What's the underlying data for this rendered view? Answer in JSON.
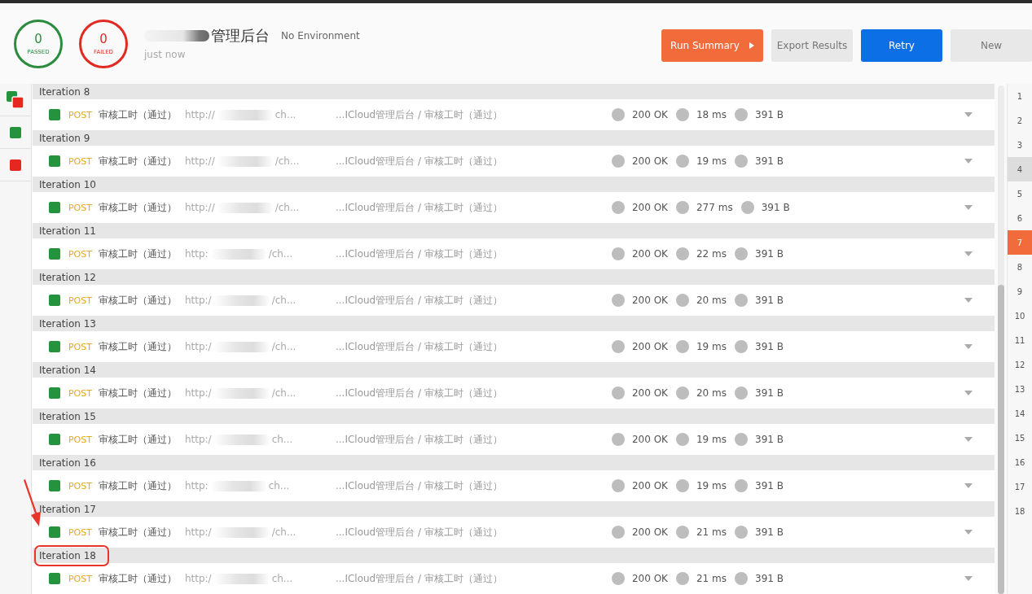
{
  "summary": {
    "passed": "0",
    "passed_label": "PASSED",
    "failed": "0",
    "failed_label": "FAILED"
  },
  "run": {
    "title": "管理后台",
    "time": "just now",
    "environment": "No Environment"
  },
  "buttons": [
    {
      "label": "Run Summary",
      "kind": "primary"
    },
    {
      "label": "Export Results",
      "kind": "plain"
    },
    {
      "label": "Retry",
      "kind": "accent"
    },
    {
      "label": "New",
      "kind": "plain"
    }
  ],
  "filters": [
    {
      "kind": "all"
    },
    {
      "kind": "passed"
    },
    {
      "kind": "failed"
    }
  ],
  "iterations": [
    {
      "label": "Iteration 8",
      "highlighted": false,
      "request": {
        "passed": true,
        "method": "POST",
        "name": "审核工时（通过）",
        "url_start": "http://",
        "url_end": "ch...",
        "path": "...ICloud管理后台 / 审核工时（通过）",
        "status": "200 OK",
        "time": "18 ms",
        "size": "391 B"
      }
    },
    {
      "label": "Iteration 9",
      "highlighted": false,
      "request": {
        "passed": true,
        "method": "POST",
        "name": "审核工时（通过）",
        "url_start": "http://",
        "url_end": "/ch...",
        "path": "...ICloud管理后台 / 审核工时（通过）",
        "status": "200 OK",
        "time": "19 ms",
        "size": "391 B"
      }
    },
    {
      "label": "Iteration 10",
      "highlighted": false,
      "request": {
        "passed": true,
        "method": "POST",
        "name": "审核工时（通过）",
        "url_start": "http://",
        "url_end": "/ch...",
        "path": "...ICloud管理后台 / 审核工时（通过）",
        "status": "200 OK",
        "time": "277 ms",
        "size": "391 B"
      }
    },
    {
      "label": "Iteration 11",
      "highlighted": false,
      "request": {
        "passed": true,
        "method": "POST",
        "name": "审核工时（通过）",
        "url_start": "http:",
        "url_end": "/ch...",
        "path": "...ICloud管理后台 / 审核工时（通过）",
        "status": "200 OK",
        "time": "22 ms",
        "size": "391 B"
      }
    },
    {
      "label": "Iteration 12",
      "highlighted": false,
      "request": {
        "passed": true,
        "method": "POST",
        "name": "审核工时（通过）",
        "url_start": "http:/",
        "url_end": "/ch...",
        "path": "...ICloud管理后台 / 审核工时（通过）",
        "status": "200 OK",
        "time": "20 ms",
        "size": "391 B"
      }
    },
    {
      "label": "Iteration 13",
      "highlighted": false,
      "request": {
        "passed": true,
        "method": "POST",
        "name": "审核工时（通过）",
        "url_start": "http:/",
        "url_end": "/ch...",
        "path": "...ICloud管理后台 / 审核工时（通过）",
        "status": "200 OK",
        "time": "19 ms",
        "size": "391 B"
      }
    },
    {
      "label": "Iteration 14",
      "highlighted": false,
      "request": {
        "passed": true,
        "method": "POST",
        "name": "审核工时（通过）",
        "url_start": "http:/",
        "url_end": "/ch...",
        "path": "...ICloud管理后台 / 审核工时（通过）",
        "status": "200 OK",
        "time": "20 ms",
        "size": "391 B"
      }
    },
    {
      "label": "Iteration 15",
      "highlighted": false,
      "request": {
        "passed": true,
        "method": "POST",
        "name": "审核工时（通过）",
        "url_start": "http:/",
        "url_end": "ch...",
        "path": "...ICloud管理后台 / 审核工时（通过）",
        "status": "200 OK",
        "time": "19 ms",
        "size": "391 B"
      }
    },
    {
      "label": "Iteration 16",
      "highlighted": false,
      "request": {
        "passed": true,
        "method": "POST",
        "name": "审核工时（通过）",
        "url_start": "http:",
        "url_end": "ch...",
        "path": "...ICloud管理后台 / 审核工时（通过）",
        "status": "200 OK",
        "time": "19 ms",
        "size": "391 B"
      }
    },
    {
      "label": "Iteration 17",
      "highlighted": false,
      "request": {
        "passed": true,
        "method": "POST",
        "name": "审核工时（通过）",
        "url_start": "http:/",
        "url_end": "/ch...",
        "path": "...ICloud管理后台 / 审核工时（通过）",
        "status": "200 OK",
        "time": "21 ms",
        "size": "391 B"
      }
    },
    {
      "label": "Iteration 18",
      "highlighted": true,
      "request": {
        "passed": true,
        "method": "POST",
        "name": "审核工时（通过）",
        "url_start": "http:/",
        "url_end": "ch...",
        "path": "...ICloud管理后台 / 审核工时（通过）",
        "status": "200 OK",
        "time": "21 ms",
        "size": "391 B"
      }
    }
  ],
  "iteration_nav": [
    {
      "label": "1",
      "selected": false,
      "hovered": false
    },
    {
      "label": "2",
      "selected": false,
      "hovered": false
    },
    {
      "label": "3",
      "selected": false,
      "hovered": false
    },
    {
      "label": "4",
      "selected": false,
      "hovered": true
    },
    {
      "label": "5",
      "selected": false,
      "hovered": false
    },
    {
      "label": "6",
      "selected": false,
      "hovered": false
    },
    {
      "label": "7",
      "selected": true,
      "hovered": false
    },
    {
      "label": "8",
      "selected": false,
      "hovered": false
    },
    {
      "label": "9",
      "selected": false,
      "hovered": false
    },
    {
      "label": "10",
      "selected": false,
      "hovered": false
    },
    {
      "label": "11",
      "selected": false,
      "hovered": false
    },
    {
      "label": "12",
      "selected": false,
      "hovered": false
    },
    {
      "label": "13",
      "selected": false,
      "hovered": false
    },
    {
      "label": "14",
      "selected": false,
      "hovered": false
    },
    {
      "label": "15",
      "selected": false,
      "hovered": false
    },
    {
      "label": "16",
      "selected": false,
      "hovered": false
    },
    {
      "label": "17",
      "selected": false,
      "hovered": false
    },
    {
      "label": "18",
      "selected": false,
      "hovered": false
    }
  ]
}
